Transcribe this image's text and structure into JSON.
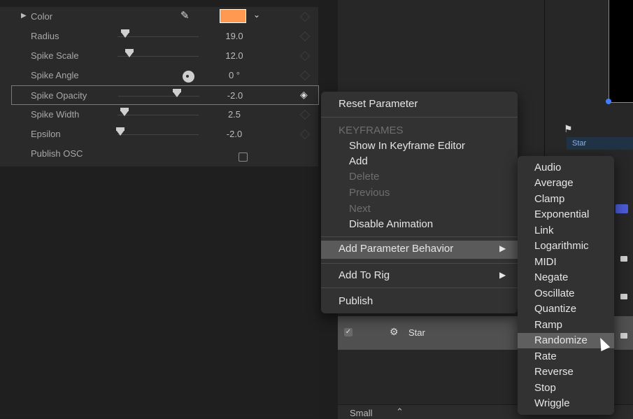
{
  "inspector": {
    "color_label": "Color",
    "rows": [
      {
        "label": "Radius",
        "value": "19.0"
      },
      {
        "label": "Spike Scale",
        "value": "12.0"
      },
      {
        "label": "Spike Angle",
        "value": "0 °"
      },
      {
        "label": "Spike Opacity",
        "value": "-2.0"
      },
      {
        "label": "Spike Width",
        "value": "2.5"
      },
      {
        "label": "Epsilon",
        "value": "-2.0"
      },
      {
        "label": "Publish OSC",
        "value": ""
      }
    ],
    "swatch_color": "#ff9850"
  },
  "timeline": {
    "track_label": "Star"
  },
  "layers": {
    "row_name": "Star"
  },
  "footer": {
    "size_label": "Small"
  },
  "context_menu": {
    "reset": "Reset Parameter",
    "keyframes_header": "KEYFRAMES",
    "show_in_editor": "Show In Keyframe Editor",
    "add": "Add",
    "delete": "Delete",
    "previous": "Previous",
    "next": "Next",
    "disable_animation": "Disable Animation",
    "add_parameter_behavior": "Add Parameter Behavior",
    "add_to_rig": "Add To Rig",
    "publish": "Publish"
  },
  "submenu": {
    "items": [
      "Audio",
      "Average",
      "Clamp",
      "Exponential",
      "Link",
      "Logarithmic",
      "MIDI",
      "Negate",
      "Oscillate",
      "Quantize",
      "Ramp",
      "Randomize",
      "Rate",
      "Reverse",
      "Stop",
      "Wriggle"
    ],
    "highlighted": "Randomize"
  }
}
